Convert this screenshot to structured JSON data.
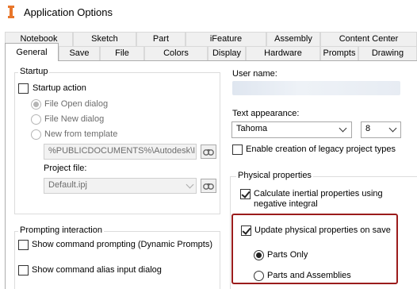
{
  "window": {
    "title": "Application Options"
  },
  "tabs": {
    "row_back": [
      "Notebook",
      "Sketch",
      "Part",
      "iFeature",
      "Assembly",
      "Content Center"
    ],
    "row_front": [
      "General",
      "Save",
      "File",
      "Colors",
      "Display",
      "Hardware",
      "Prompts",
      "Drawing"
    ],
    "active": "General"
  },
  "startup": {
    "title": "Startup",
    "startup_action": {
      "label": "Startup action",
      "checked": false
    },
    "options": [
      {
        "label": "File Open dialog",
        "selected": true
      },
      {
        "label": "File New dialog",
        "selected": false
      },
      {
        "label": "New from template",
        "selected": false
      }
    ],
    "template_path": "%PUBLICDOCUMENTS%\\Autodesk\\Inv",
    "project_file_label": "Project file:",
    "project_file_value": "Default.ipj"
  },
  "user": {
    "name_label": "User name:",
    "text_appearance_label": "Text appearance:",
    "font": "Tahoma",
    "font_size": "8",
    "legacy_types": {
      "label": "Enable creation of legacy project types",
      "checked": false
    }
  },
  "physical": {
    "title": "Physical properties",
    "inertial": {
      "label_line1": "Calculate inertial properties using",
      "label_line2": "negative integral",
      "checked": true
    },
    "update_on_save": {
      "label": "Update physical properties on save",
      "checked": true
    },
    "scope_options": [
      {
        "label": "Parts Only",
        "selected": true
      },
      {
        "label": "Parts and Assemblies",
        "selected": false
      }
    ]
  },
  "prompting": {
    "title": "Prompting interaction",
    "dynamic_prompts": {
      "label": "Show command prompting (Dynamic Prompts)",
      "checked": false
    },
    "alias_dialog": {
      "label": "Show command alias input dialog",
      "checked": false
    }
  },
  "colors": {
    "highlight": "#9b1c1c",
    "app_icon": "#e8762b"
  }
}
